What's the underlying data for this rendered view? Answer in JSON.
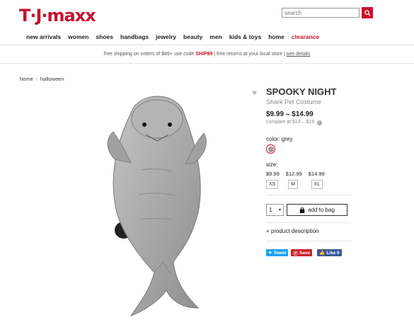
{
  "header": {
    "logo": "T·J·maxx",
    "search_placeholder": "search"
  },
  "nav": {
    "items": [
      "new arrivals",
      "women",
      "shoes",
      "handbags",
      "jewelry",
      "beauty",
      "men",
      "kids & toys",
      "home"
    ],
    "clearance": "clearance"
  },
  "promo": {
    "prefix": "free shipping on orders of $89+ use code ",
    "code": "SHIP89",
    "middle": " | free returns at your local store | ",
    "link": "see details"
  },
  "breadcrumb": {
    "home": "home",
    "sep": "/",
    "current": "halloween"
  },
  "product": {
    "brand": "SPOOKY NIGHT",
    "name": "Shark Pet Costume",
    "price": "$9.99 – $14.99",
    "compare": "compare at  $14 – $19",
    "color_label": "color:  grey",
    "size_label": "size:",
    "size_prices": [
      "$9.99",
      "$12.99",
      "$14.99"
    ],
    "sizes": [
      "XS",
      "M",
      "XL"
    ],
    "qty": "1",
    "add_to_bag": "add to bag",
    "description": "+  product description",
    "swatch_color": "#999999"
  },
  "social": {
    "tweet": "Tweet",
    "save": "Save",
    "like": "Like 0"
  },
  "colors": {
    "brand_red": "#c8102e"
  }
}
